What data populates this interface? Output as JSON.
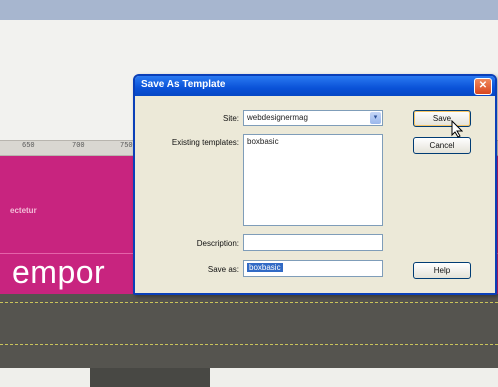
{
  "background": {
    "ruler_ticks": [
      "650",
      "700",
      "750"
    ],
    "nav_text": "ectetur",
    "banner_text": "empor"
  },
  "dialog": {
    "title": "Save As Template",
    "close_label": "✕",
    "site_label": "Site:",
    "site_value": "webdesignermag",
    "existing_label": "Existing templates:",
    "existing_templates": [
      "boxbasic"
    ],
    "description_label": "Description:",
    "description_value": "",
    "save_as_label": "Save as:",
    "save_as_value": "boxbasic",
    "buttons": {
      "save": "Save",
      "cancel": "Cancel",
      "help": "Help"
    }
  },
  "colors": {
    "titlebar": "#0a52d8",
    "magenta_banner": "#c8247f",
    "selection": "#316ac5"
  },
  "icons": [
    "close-icon",
    "dropdown-arrow-icon",
    "mouse-cursor-icon"
  ]
}
